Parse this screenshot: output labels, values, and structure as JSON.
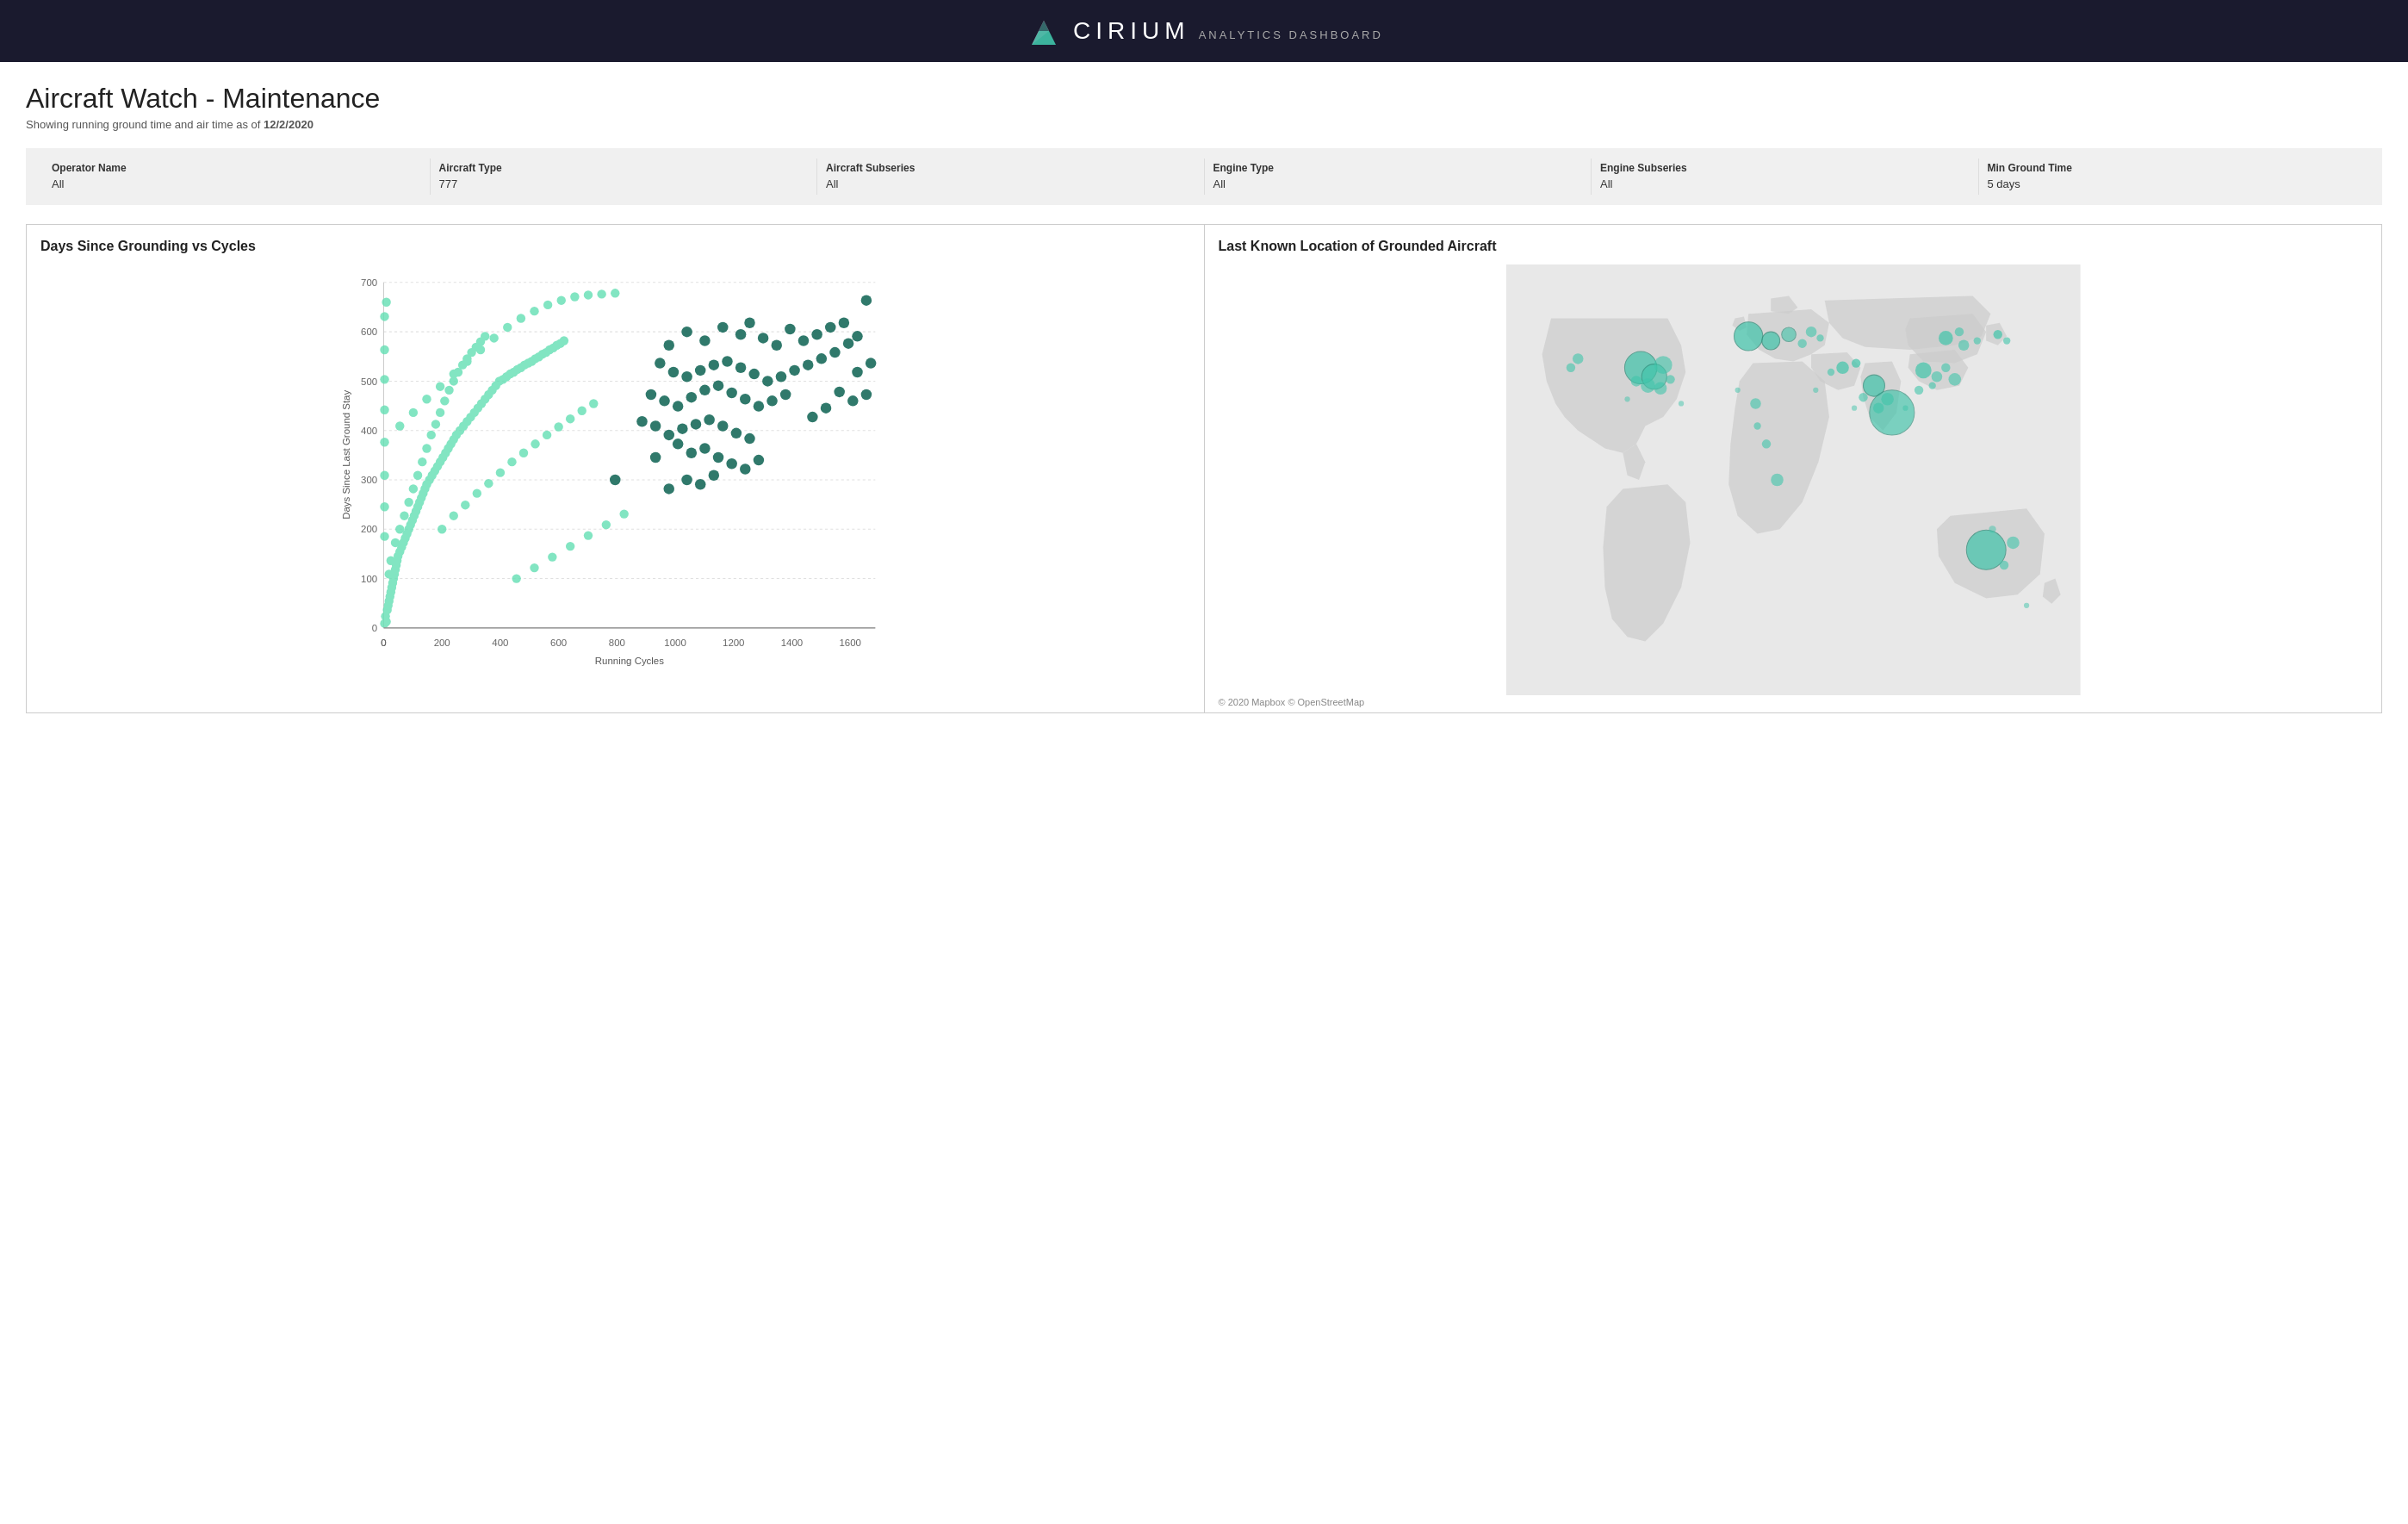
{
  "header": {
    "brand": "CIRIUM",
    "tagline": "ANALYTICS DASHBOARD"
  },
  "page": {
    "title": "Aircraft Watch - Maintenance",
    "subtitle_prefix": "Showing running ground time and air time as of ",
    "subtitle_date": "12/2/2020"
  },
  "filters": [
    {
      "label": "Operator Name",
      "value": "All"
    },
    {
      "label": "Aircraft Type",
      "value": "777"
    },
    {
      "label": "Aircraft Subseries",
      "value": "All"
    },
    {
      "label": "Engine Type",
      "value": "All"
    },
    {
      "label": "Engine Subseries",
      "value": "All"
    },
    {
      "label": "Min Ground Time",
      "value": "5 days"
    }
  ],
  "scatter_chart": {
    "title": "Days Since Grounding vs Cycles",
    "x_axis_label": "Running Cycles",
    "y_axis_label": "Days Since Last Ground Stay",
    "x_ticks": [
      0,
      200,
      400,
      600,
      800,
      1000,
      1200,
      1400,
      1600
    ],
    "y_ticks": [
      0,
      100,
      200,
      300,
      400,
      500,
      600,
      700
    ]
  },
  "map_chart": {
    "title": "Last Known Location of Grounded Aircraft",
    "footer": "© 2020 Mapbox © OpenStreetMap"
  }
}
